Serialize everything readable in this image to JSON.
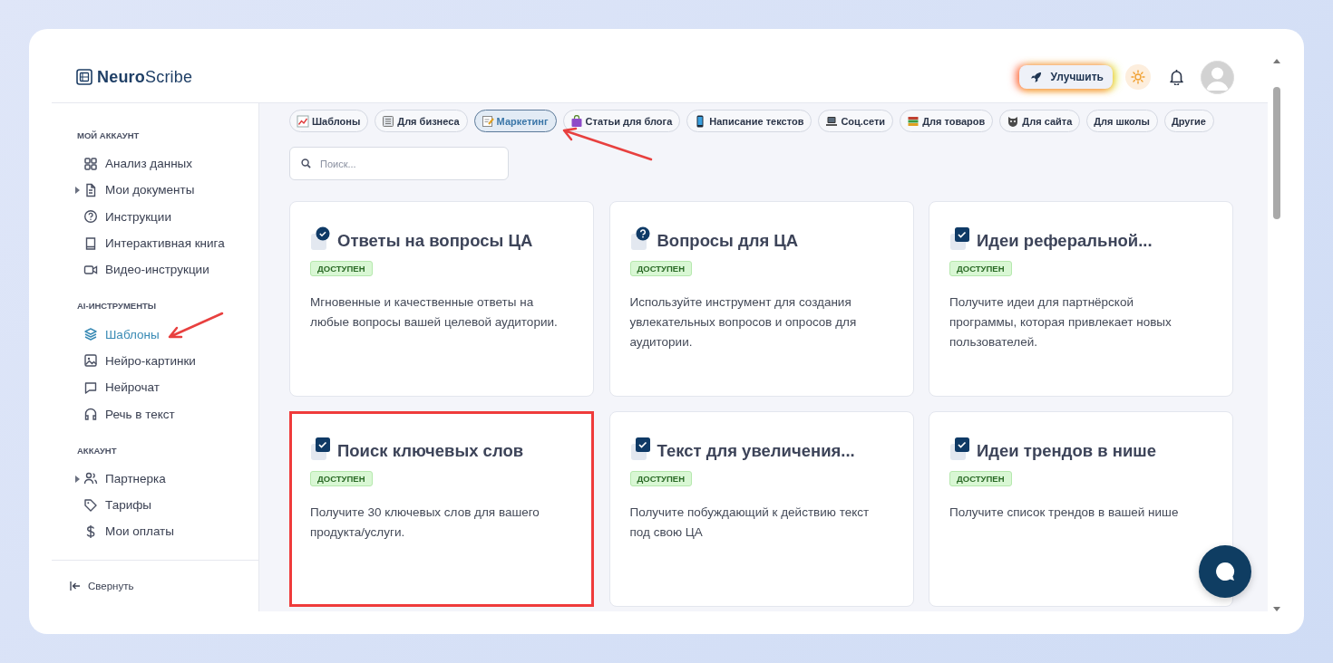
{
  "logo": {
    "bold": "Neuro",
    "light": "Scribe"
  },
  "header": {
    "upgrade_button": "Улучшить"
  },
  "sidebar": {
    "sections": [
      {
        "title": "МОЙ АККАУНТ",
        "items": [
          {
            "label": "Анализ данных",
            "kind": "link",
            "selected": false
          },
          {
            "label": "Мои документы",
            "kind": "group",
            "selected": false
          },
          {
            "label": "Инструкции",
            "kind": "link",
            "selected": false
          },
          {
            "label": "Интерактивная книга",
            "kind": "link",
            "selected": false
          },
          {
            "label": "Видео-инструкции",
            "kind": "link",
            "selected": false
          }
        ]
      },
      {
        "title": "AI-ИНСТРУМЕНТЫ",
        "items": [
          {
            "label": "Шаблоны",
            "kind": "link",
            "selected": true
          },
          {
            "label": "Нейро-картинки",
            "kind": "link",
            "selected": false
          },
          {
            "label": "Нейрочат",
            "kind": "link",
            "selected": false
          },
          {
            "label": "Речь в текст",
            "kind": "link",
            "selected": false
          }
        ]
      },
      {
        "title": "АККАУНТ",
        "items": [
          {
            "label": "Партнерка",
            "kind": "group",
            "selected": false
          },
          {
            "label": "Тарифы",
            "kind": "link",
            "selected": false
          },
          {
            "label": "Мои оплаты",
            "kind": "link",
            "selected": false
          }
        ]
      }
    ],
    "collapse": "Свернуть"
  },
  "chips": [
    {
      "label": "Шаблоны",
      "selected": false
    },
    {
      "label": "Для бизнеса",
      "selected": false
    },
    {
      "label": "Маркетинг",
      "selected": true
    },
    {
      "label": "Статьи для блога",
      "selected": false
    },
    {
      "label": "Написание текстов",
      "selected": false
    },
    {
      "label": "Соц.сети",
      "selected": false
    },
    {
      "label": "Для товаров",
      "selected": false
    },
    {
      "label": "Для сайта",
      "selected": false
    },
    {
      "label": "Для школы",
      "selected": false
    },
    {
      "label": "Другие",
      "selected": false
    }
  ],
  "search": {
    "placeholder": "Поиск..."
  },
  "cards": [
    {
      "title": "Ответы на вопросы ЦА",
      "badge": "ДОСТУПЕН",
      "description": "Мгновенные и качественные ответы на любые вопросы вашей целевой аудитории.",
      "highlighted": false
    },
    {
      "title": "Вопросы для ЦА",
      "badge": "ДОСТУПЕН",
      "description": "Используйте инструмент для создания увлекательных вопросов и опросов для аудитории.",
      "highlighted": false
    },
    {
      "title": "Идеи реферальной...",
      "badge": "ДОСТУПЕН",
      "description": "Получите идеи для партнёрской программы, которая привлекает новых пользователей.",
      "highlighted": false
    },
    {
      "title": "Поиск ключевых слов",
      "badge": "ДОСТУПЕН",
      "description": "Получите 30 ключевых слов для вашего продукта/услуги.",
      "highlighted": true
    },
    {
      "title": "Текст для увеличения...",
      "badge": "ДОСТУПЕН",
      "description": "Получите побуждающий к действию текст под свою ЦА",
      "highlighted": false
    },
    {
      "title": "Идеи трендов в нише",
      "badge": "ДОСТУПЕН",
      "description": "Получите список трендов в вашей нише",
      "highlighted": false
    }
  ]
}
